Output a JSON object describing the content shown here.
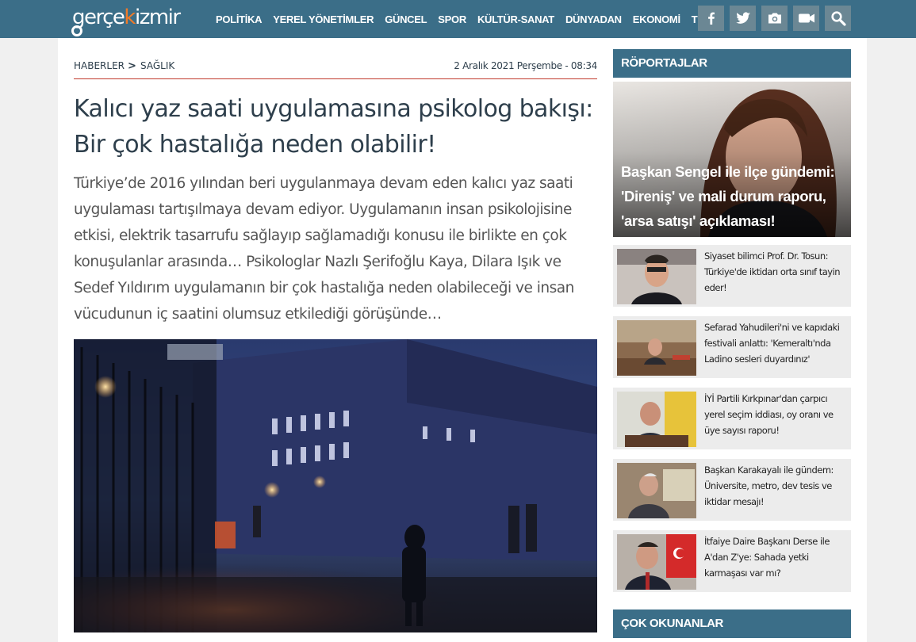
{
  "site": {
    "logo_part1": "gerçe",
    "logo_part2": "k",
    "logo_part3": "izmir",
    "brand_color": "#3b6e88",
    "accent_color": "#f07a28"
  },
  "nav": {
    "items": [
      "POLİTİKA",
      "YEREL YÖNETİMLER",
      "GÜNCEL",
      "SPOR",
      "KÜLTÜR-SANAT",
      "DÜNYADAN",
      "EKONOMİ",
      "TÜMÜ"
    ]
  },
  "header_icons": [
    "facebook-icon",
    "twitter-icon",
    "camera-icon",
    "video-icon",
    "search-icon"
  ],
  "breadcrumb": {
    "root": "HABERLER",
    "separator": ">",
    "category": "SAĞLIK",
    "date": "2 Aralık 2021 Perşembe - 08:34"
  },
  "article": {
    "title": "Kalıcı yaz saati uygulamasına psikolog bakışı: Bir çok hastalığa neden olabilir!",
    "summary": "Türkiye’de 2016 yılından beri uygulanmaya devam eden kalıcı yaz saati uygulaması tartışılmaya devam ediyor. Uygulamanın insan psikolojisine etkisi, elektrik tasarrufu sağlayıp sağlamadığı konusu ile birlikte en çok konuşulanlar arasında… Psikologlar Nazlı Şerifoğlu Kaya, Dilara Işık ve Sedef Yıldırım uygulamanın bir çok hastalığa neden olabileceği ve insan vücudunun iç saatini olumsuz etkilediği görüşünde…"
  },
  "sidebar": {
    "interviews_title": "RÖPORTAJLAR",
    "feature_text": "Başkan Sengel ile ilçe gündemi: 'Direniş' ve mali durum raporu, 'arsa satışı' açıklaması!",
    "items": [
      {
        "text": "Siyaset bilimci Prof. Dr. Tosun: Türkiye'de iktidarı orta sınıf tayin eder!"
      },
      {
        "text": "Sefarad Yahudileri'ni ve kapıdaki festivali anlattı: 'Kemeraltı'nda Ladino sesleri duyardınız'"
      },
      {
        "text": "İYİ Partili Kırkpınar'dan çarpıcı yerel seçim iddiası, oy oranı ve üye sayısı raporu!"
      },
      {
        "text": "Başkan Karakayalı ile gündem: Üniversite, metro, dev tesis ve iktidar mesajı!"
      },
      {
        "text": "İtfaiye Daire Başkanı Derse ile A'dan Z'ye: Sahada yetki karmaşası var mı?"
      }
    ],
    "most_read_title": "ÇOK OKUNANLAR"
  }
}
